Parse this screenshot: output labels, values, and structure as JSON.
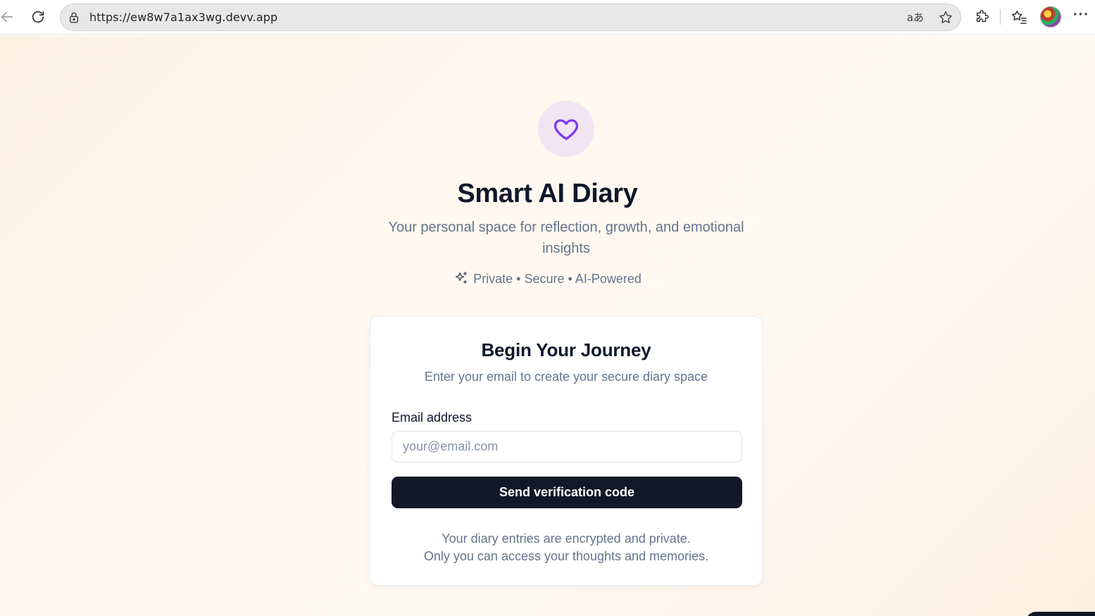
{
  "browser": {
    "url": "https://ew8w7a1ax3wg.devv.app",
    "read_aloud_label": "aあ"
  },
  "app": {
    "title": "Smart AI Diary",
    "subtitle": "Your personal space for reflection, growth, and emotional insights",
    "tagline": "Private • Secure • AI-Powered"
  },
  "card": {
    "title": "Begin Your Journey",
    "subtitle": "Enter your email to create your secure diary space",
    "email_label": "Email address",
    "email_placeholder": "your@email.com",
    "email_value": "",
    "send_button": "Send verification code",
    "note_line1": "Your diary entries are encrypted and private.",
    "note_line2": "Only you can access your thoughts and memories."
  },
  "colors": {
    "accent": "#7c3aed",
    "logo_bg": "#f1e5f4",
    "button_bg": "#111827",
    "muted_text": "#64748b"
  },
  "icons": {
    "back": "arrow-left-icon",
    "reload": "reload-icon",
    "lock": "lock-icon",
    "favorite": "star-icon",
    "extensions": "puzzle-icon",
    "favorites": "favorites-list-icon",
    "menu": "more-icon",
    "logo": "heart-icon",
    "tagline": "sparkles-icon"
  }
}
